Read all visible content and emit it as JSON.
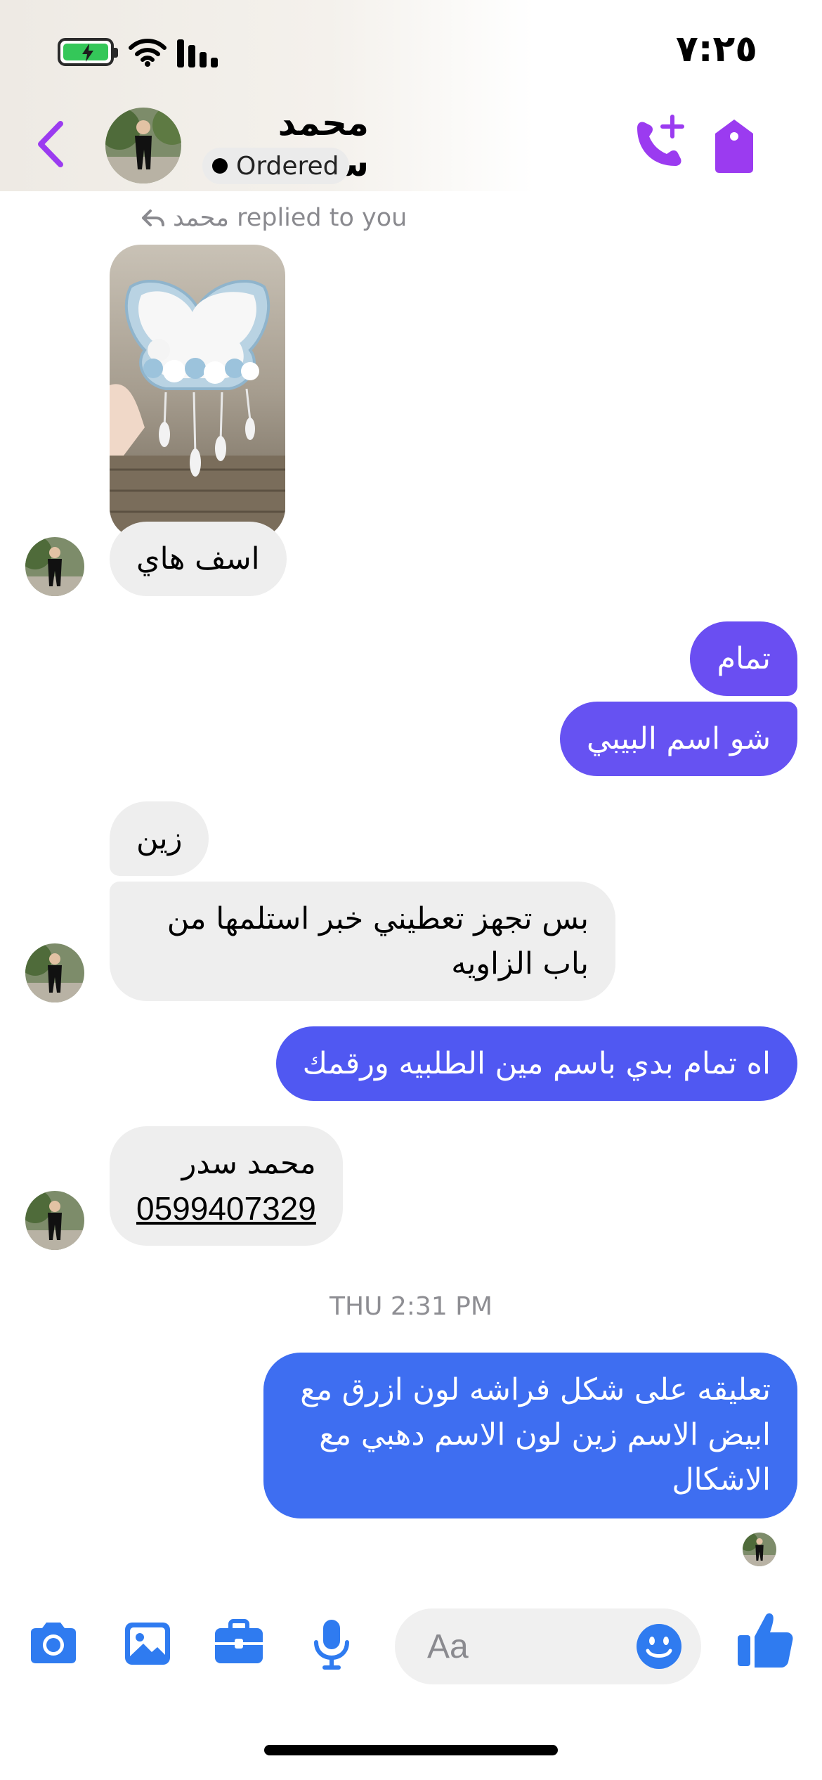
{
  "status_bar": {
    "time": "٧:٢٥"
  },
  "header": {
    "contact_name": "محمد سدر",
    "status_badge": "Ordered"
  },
  "chat": {
    "replied_notice": "محمد replied to you",
    "messages": [
      {
        "id": "m1",
        "direction": "incoming",
        "text": "اسف هاي"
      },
      {
        "id": "m2",
        "direction": "outgoing",
        "text": "تمام"
      },
      {
        "id": "m3",
        "direction": "outgoing",
        "text": "شو اسم البيبي"
      },
      {
        "id": "m4",
        "direction": "incoming",
        "text": "زين"
      },
      {
        "id": "m5",
        "direction": "incoming",
        "lines": [
          "بس تجهز تعطيني خبر استلمها من",
          "باب الزاويه"
        ]
      },
      {
        "id": "m6",
        "direction": "outgoing",
        "text": "اه تمام بدي باسم مين الطلبيه ورقمك"
      },
      {
        "id": "m7",
        "direction": "incoming",
        "name_line": "محمد سدر",
        "phone": "0599407329"
      },
      {
        "id": "m8",
        "direction": "outgoing",
        "lines": [
          "تعليقه على شكل فراشه لون ازرق مع",
          "ابيض الاسم زين لون الاسم دهبي مع",
          "الاشكال"
        ]
      }
    ],
    "timestamp": "THU 2:31 PM"
  },
  "composer": {
    "placeholder": "Aa",
    "icons": [
      "camera-icon",
      "gallery-icon",
      "briefcase-icon",
      "microphone-icon",
      "emoji-icon",
      "thumbs-up-icon"
    ]
  },
  "colors": {
    "accent_purple": "#9b3bf0",
    "bubble_outgoing_top": "#6a4ef2",
    "bubble_outgoing_mid": "#5057f2",
    "bubble_outgoing_bottom": "#3e6ef1",
    "bubble_incoming": "#eeeeee",
    "composer_blue": "#2f7bf0"
  }
}
